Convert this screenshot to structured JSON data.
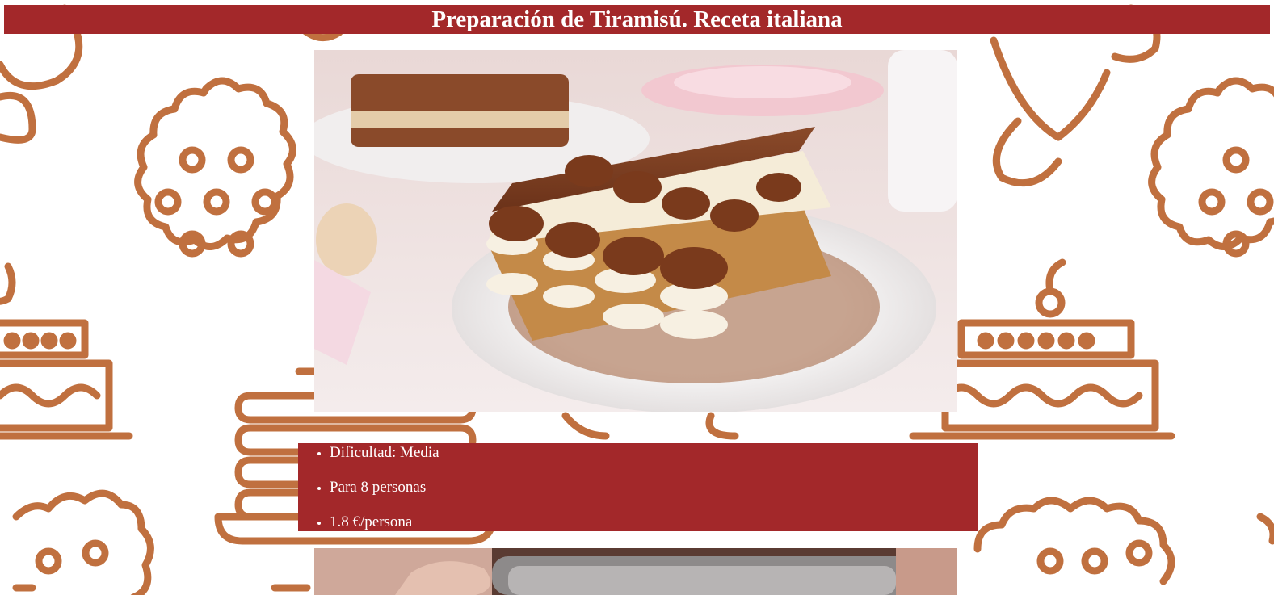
{
  "page": {
    "title": "Preparación de Tiramisú. Receta italiana"
  },
  "recipe": {
    "details": [
      "Dificultad: Media",
      "Para 8 personas",
      "1.8 €/persona"
    ]
  },
  "images": {
    "main": "tiramisu-plate-photo",
    "secondary": "preparation-hands-photo"
  },
  "theme": {
    "accent": "#a3282a",
    "pattern_color": "#c0703f",
    "text_on_accent": "#ffffff"
  }
}
